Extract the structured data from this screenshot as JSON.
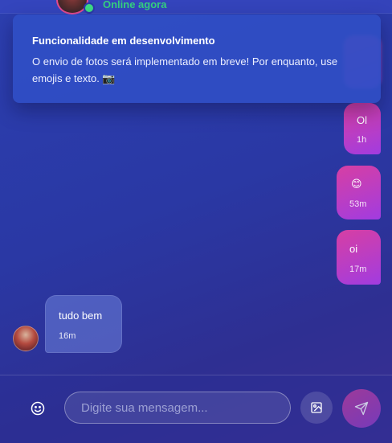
{
  "header": {
    "status": "Online agora"
  },
  "toast": {
    "title": "Funcionalidade em desenvolvimento",
    "body": "O envio de fotos será implementado em breve! Por enquanto, use emojis e texto. 📷"
  },
  "messages": [
    {
      "text": "Ol",
      "time": "1h",
      "direction": "out"
    },
    {
      "text": "😊",
      "time": "53m",
      "direction": "out"
    },
    {
      "text": "oi",
      "time": "17m",
      "direction": "out"
    },
    {
      "text": "tudo bem",
      "time": "16m",
      "direction": "in"
    }
  ],
  "composer": {
    "placeholder": "Digite sua mensagem..."
  },
  "icons": {
    "emoji": "smiley-icon",
    "image": "image-icon",
    "send": "send-icon"
  },
  "colors": {
    "background": "#2c3fb0",
    "bubble_out_start": "#d73fa3",
    "bubble_out_end": "#a13ce0",
    "online": "#35d07f"
  }
}
